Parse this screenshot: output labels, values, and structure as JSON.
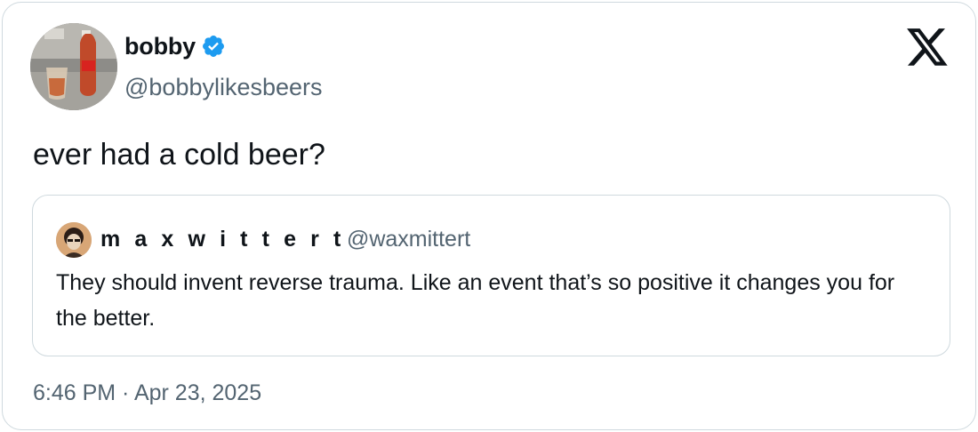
{
  "author": {
    "display_name": "bobby",
    "handle": "@bobbylikesbeers",
    "verified": true
  },
  "tweet": {
    "text": "ever had a cold beer?",
    "timestamp": "6:46 PM · Apr 23, 2025"
  },
  "quoted_tweet": {
    "display_name": "m a x w i t t e r t",
    "handle": "@waxmittert",
    "text": "They should invent reverse trauma. Like an event that’s so positive it changes you for the better."
  },
  "icons": {
    "verified": "verified-badge-icon",
    "platform": "x-logo-icon"
  },
  "colors": {
    "text": "#0f1419",
    "secondary_text": "#536471",
    "verified_blue": "#1d9bf0",
    "border": "#cfd9de"
  }
}
